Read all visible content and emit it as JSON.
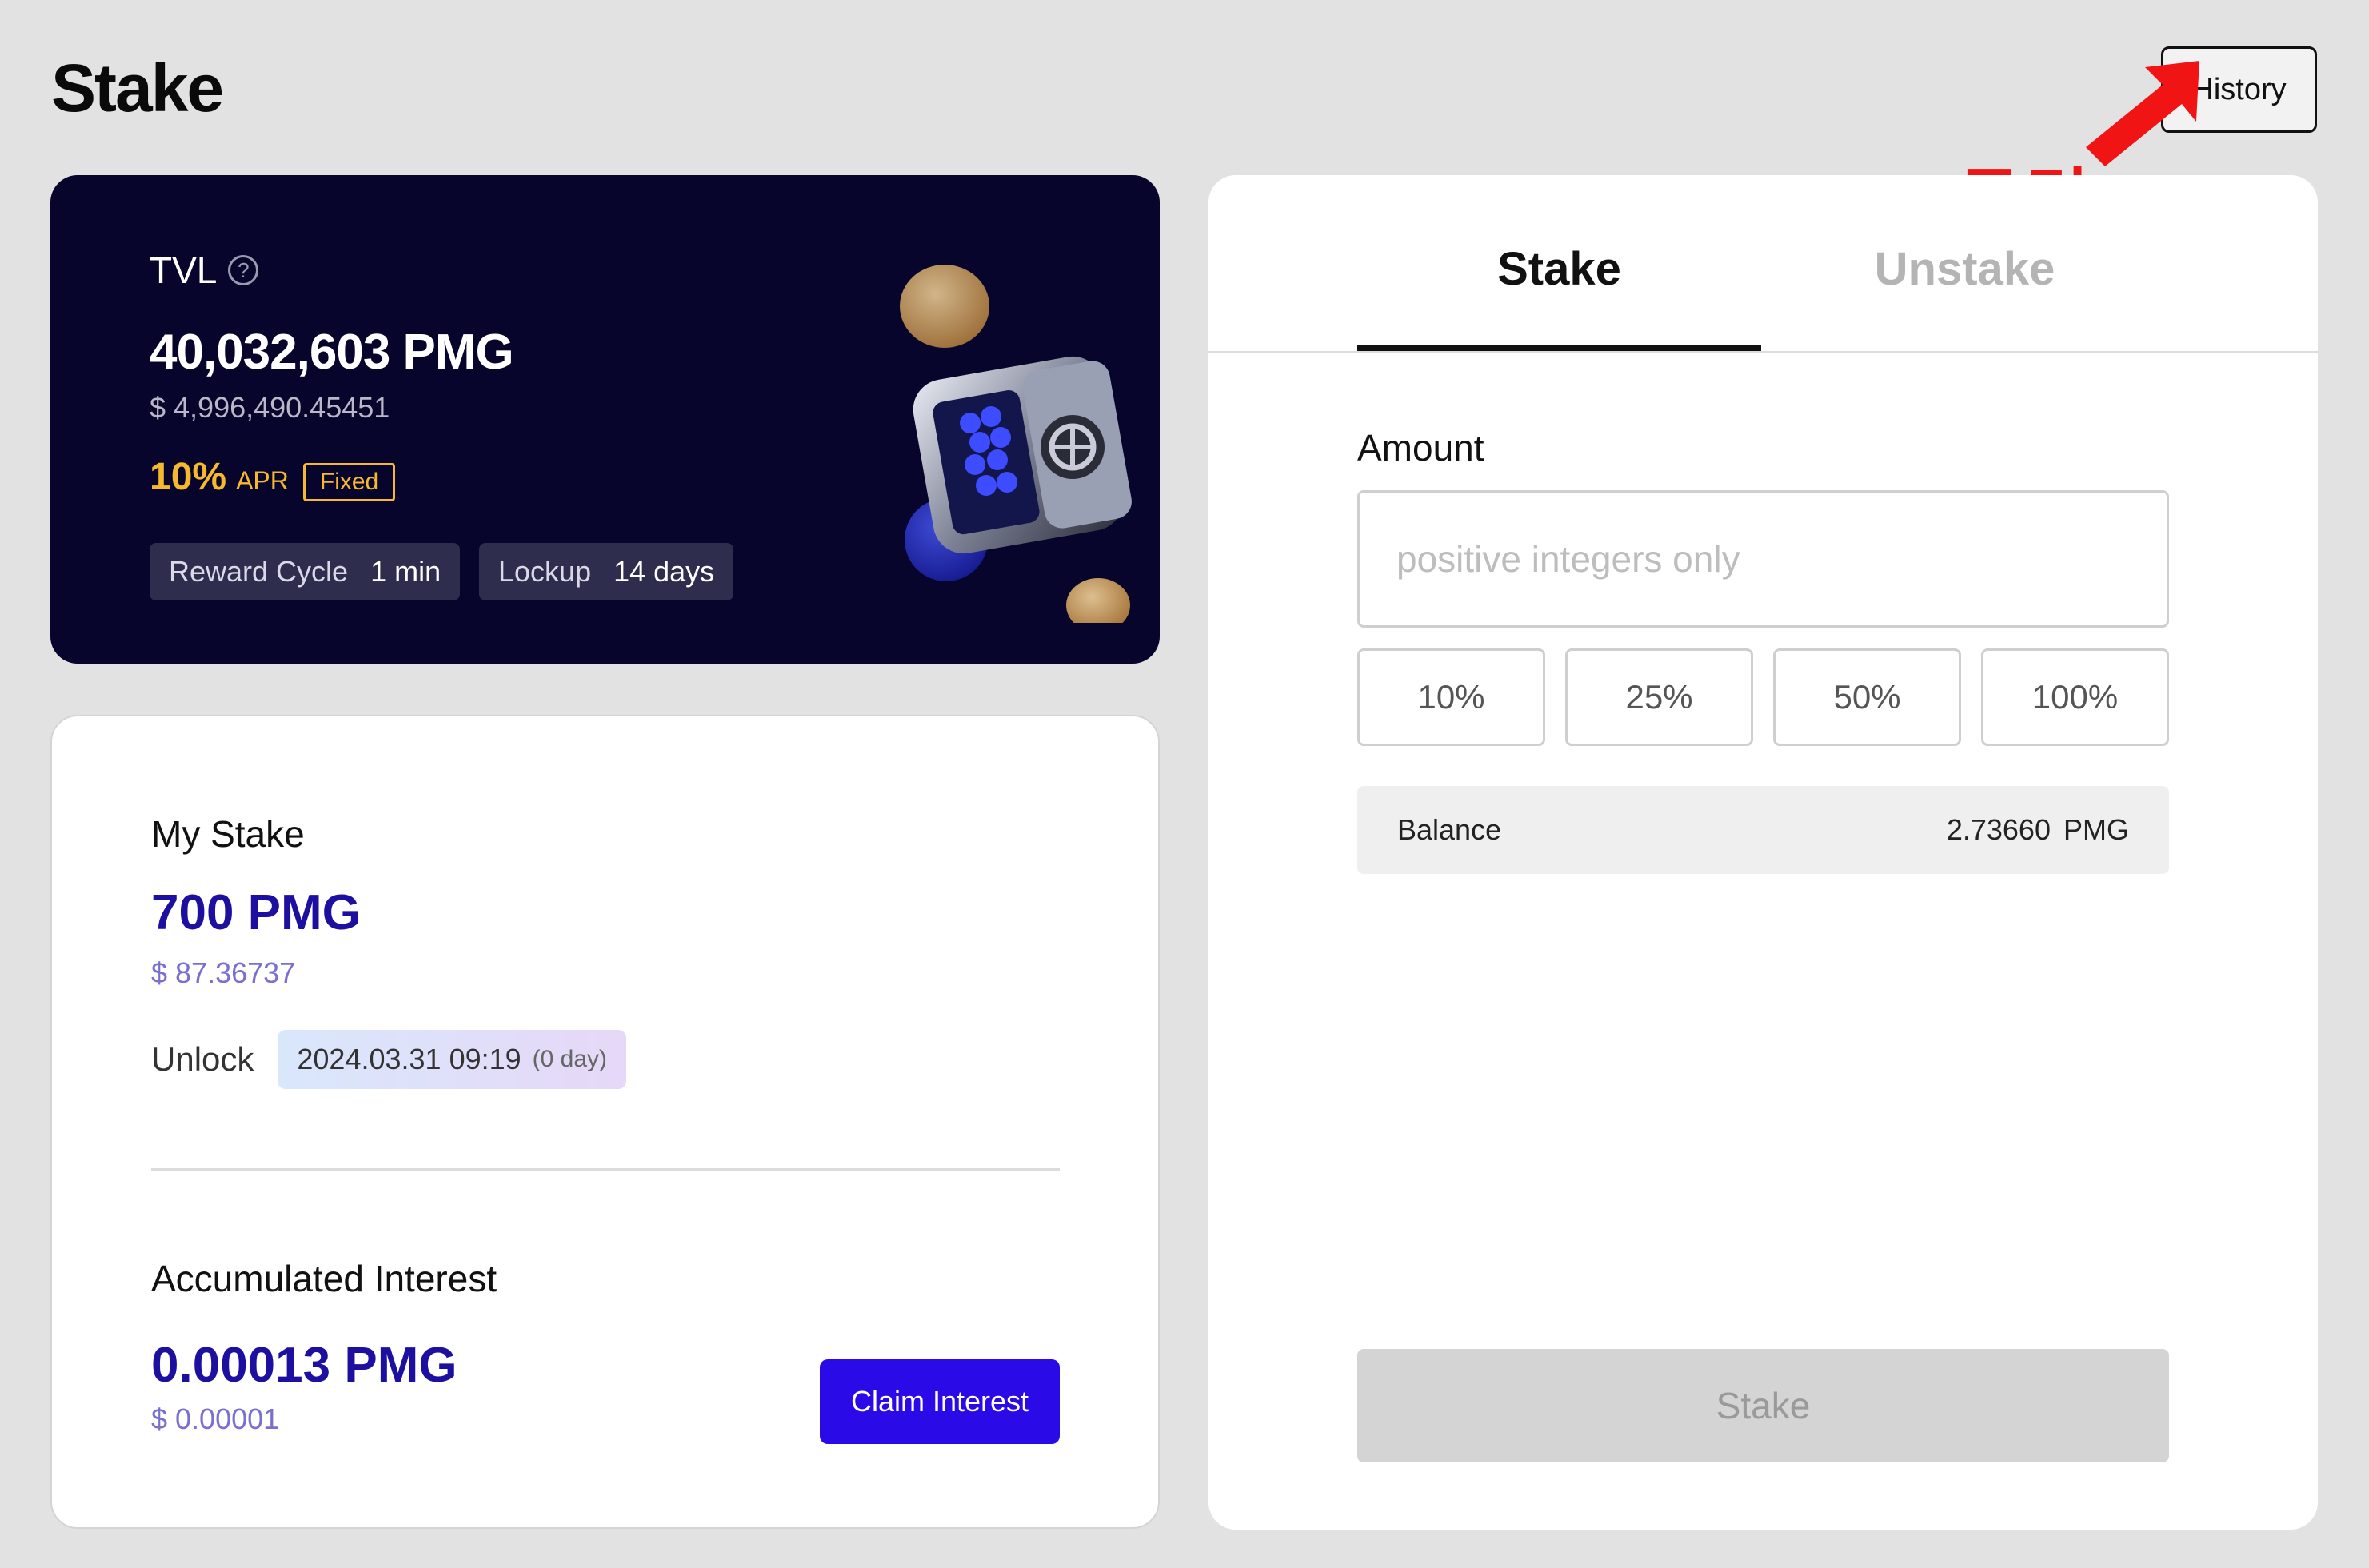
{
  "header": {
    "title": "Stake",
    "history_label": "History"
  },
  "annotation": {
    "text": "클릭",
    "color": "#f01414"
  },
  "tvl": {
    "label": "TVL",
    "help_icon": "question-circle-icon",
    "amount": "40,032,603 PMG",
    "usd": "$ 4,996,490.45451",
    "apr_value": "10%",
    "apr_label": "APR",
    "apr_type": "Fixed",
    "reward_cycle_label": "Reward Cycle",
    "reward_cycle_value": "1 min",
    "lockup_label": "Lockup",
    "lockup_value": "14 days"
  },
  "my_stake": {
    "title": "My Stake",
    "amount": "700 PMG",
    "usd": "$ 87.36737",
    "unlock_label": "Unlock",
    "unlock_date": "2024.03.31 09:19",
    "unlock_days": "(0 day)",
    "accumulated_title": "Accumulated Interest",
    "accumulated_amount": "0.00013 PMG",
    "accumulated_usd": "$ 0.00001",
    "claim_label": "Claim Interest"
  },
  "panel": {
    "tabs": [
      {
        "label": "Stake",
        "active": true
      },
      {
        "label": "Unstake",
        "active": false
      }
    ],
    "amount_label": "Amount",
    "amount_value": "",
    "amount_placeholder": "positive integers only",
    "percent_options": [
      "10%",
      "25%",
      "50%",
      "100%"
    ],
    "balance_label": "Balance",
    "balance_value": "2.73660",
    "balance_unit": "PMG",
    "submit_label": "Stake"
  },
  "colors": {
    "background": "#e2e2e2",
    "dark_card": "#07052c",
    "accent_gold": "#f5b82e",
    "accent_blue": "#2a0be8",
    "amount_navy": "#1d0fa0"
  }
}
